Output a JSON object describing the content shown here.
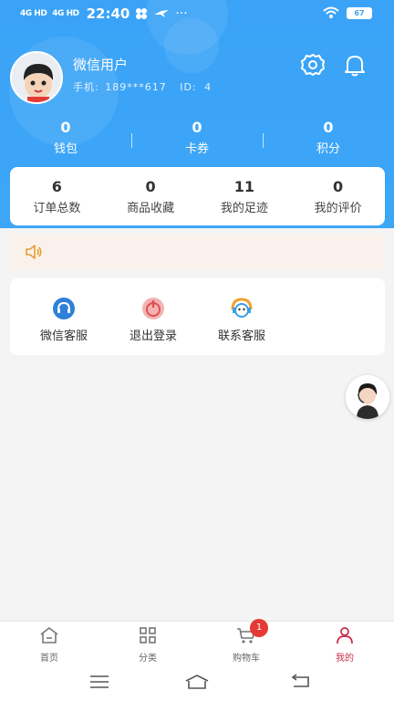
{
  "status_bar": {
    "signal1": "4G HD",
    "signal2": "4G HD",
    "time": "22:40",
    "extra": "···",
    "battery": "67"
  },
  "profile": {
    "name": "微信用户",
    "phone_label": "手机:",
    "phone": "189***617",
    "id_label": "ID:",
    "id": "4"
  },
  "wallet": [
    {
      "value": "0",
      "label": "钱包"
    },
    {
      "value": "0",
      "label": "卡券"
    },
    {
      "value": "0",
      "label": "积分"
    }
  ],
  "stats": [
    {
      "value": "6",
      "label": "订单总数"
    },
    {
      "value": "0",
      "label": "商品收藏"
    },
    {
      "value": "11",
      "label": "我的足迹"
    },
    {
      "value": "0",
      "label": "我的评价"
    }
  ],
  "services": [
    {
      "label": "微信客服",
      "icon": "headset-icon"
    },
    {
      "label": "退出登录",
      "icon": "power-icon"
    },
    {
      "label": "联系客服",
      "icon": "customer-service-icon"
    }
  ],
  "tabbar": [
    {
      "label": "首页",
      "icon": "home-icon"
    },
    {
      "label": "分类",
      "icon": "grid-icon"
    },
    {
      "label": "购物车",
      "icon": "cart-icon",
      "badge": "1"
    },
    {
      "label": "我的",
      "icon": "user-icon",
      "active": true
    }
  ],
  "colors": {
    "primary": "#3aa3f7",
    "active_tab": "#c9304c",
    "badge": "#e53935",
    "notice_bg": "#fbf1ec"
  }
}
